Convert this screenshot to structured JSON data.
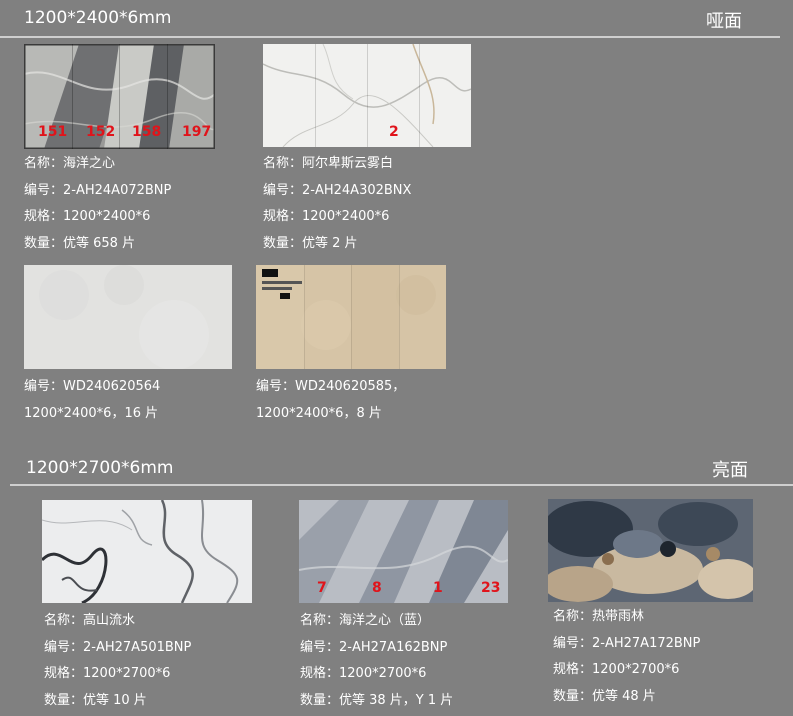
{
  "sections": [
    {
      "title": "1200*2400*6mm",
      "finish": "哑面",
      "products": [
        {
          "image": "ocean-heart-marble-slab",
          "lines": [
            "名称：海洋之心",
            "编号：2-AH24A072BNP",
            "规格：1200*2400*6",
            "数量：优等 658 片"
          ],
          "badges": [
            "151",
            "152",
            "158",
            "197"
          ]
        },
        {
          "image": "white-calacatta-slab",
          "lines": [
            "名称：阿尔卑斯云雾白",
            "编号：2-AH24A302BNX",
            "规格：1200*2400*6",
            "数量：优等 2 片"
          ],
          "badges": [
            "2"
          ]
        },
        {
          "image": "light-grey-concrete-slab",
          "lines": [
            "编号：WD240620564",
            "1200*2400*6，16 片"
          ]
        },
        {
          "image": "beige-travertine-slab",
          "lines": [
            "编号：WD240620585，",
            "1200*2400*6，8 片"
          ]
        }
      ]
    },
    {
      "title": "1200*2700*6mm",
      "finish": "亮面",
      "products": [
        {
          "image": "high-mountain-water-marble-slab",
          "lines": [
            "名称：高山流水",
            "编号：2-AH27A501BNP",
            "规格：1200*2700*6",
            "数量：优等 10 片"
          ]
        },
        {
          "image": "ocean-heart-blue-marble-slab",
          "lines": [
            "名称：海洋之心（蓝）",
            "编号：2-AH27A162BNP",
            "规格：1200*2700*6",
            "数量：优等 38 片，Y 1 片"
          ],
          "badges": [
            "7",
            "8",
            "1",
            "23"
          ]
        },
        {
          "image": "tropical-rainforest-granite-slab",
          "lines": [
            "名称：热带雨林",
            "编号：2-AH27A172BNP",
            "规格：1200*2700*6",
            "数量：优等 48 片"
          ]
        }
      ]
    }
  ],
  "colors": {
    "background": "#808080",
    "badge": "#e0141b",
    "text": "#ffffff",
    "rule": "#cfcfcf"
  }
}
